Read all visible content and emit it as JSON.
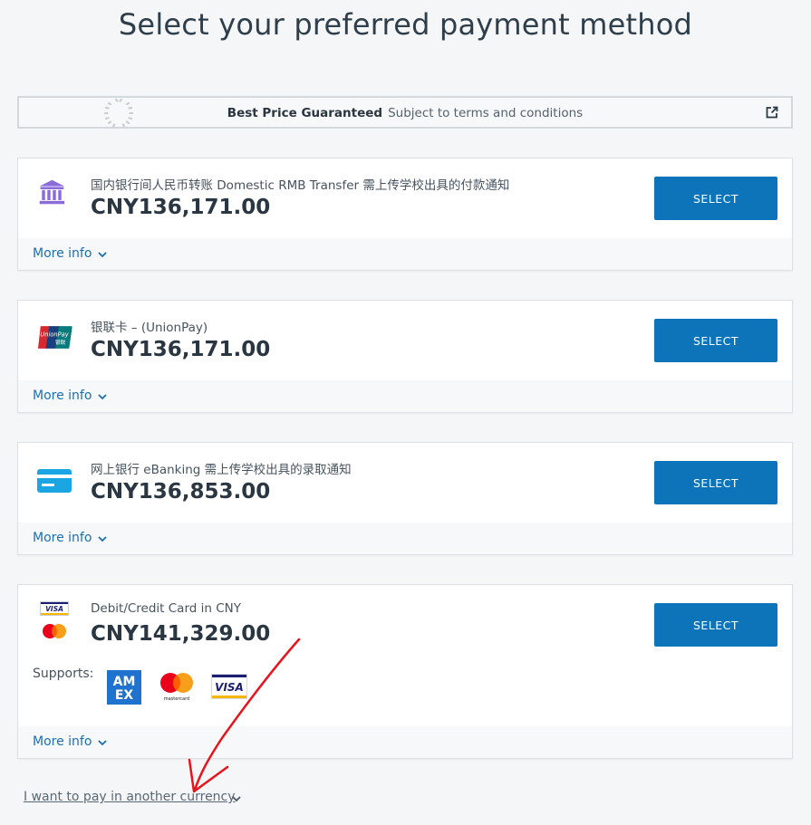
{
  "page": {
    "title": "Select your preferred payment method"
  },
  "banner": {
    "bold": "Best Price Guaranteed",
    "text": "Subject to terms and conditions"
  },
  "methods": [
    {
      "label": "国内银行间人民币转账 Domestic RMB Transfer 需上传学校出具的付款通知",
      "price": "CNY136,171.00",
      "icon": "bank-icon",
      "select": "SELECT",
      "more": "More info"
    },
    {
      "label": "银联卡 – (UnionPay)",
      "price": "CNY136,171.00",
      "icon": "unionpay-icon",
      "select": "SELECT",
      "more": "More info"
    },
    {
      "label": "网上银行 eBanking 需上传学校出具的录取通知",
      "price": "CNY136,853.00",
      "icon": "card-icon",
      "select": "SELECT",
      "more": "More info"
    },
    {
      "label": "Debit/Credit Card in CNY",
      "price": "CNY141,329.00",
      "icon": "visa-mastercard-icon",
      "select": "SELECT",
      "more": "More info",
      "supports_label": "Supports:",
      "supported": [
        "amex-logo",
        "mastercard-logo",
        "visa-logo"
      ]
    }
  ],
  "logos": {
    "unionpay": "UnionPay",
    "unionpay_cn": "银联",
    "visa": "VISA",
    "amex_top": "AM",
    "amex_bottom": "EX",
    "mastercard": "mastercard"
  },
  "currency": {
    "link": "I want to pay in another currency"
  },
  "colors": {
    "button": "#0d74b9",
    "link": "#1d6fae",
    "annotation_arrow": "#e8141b"
  }
}
